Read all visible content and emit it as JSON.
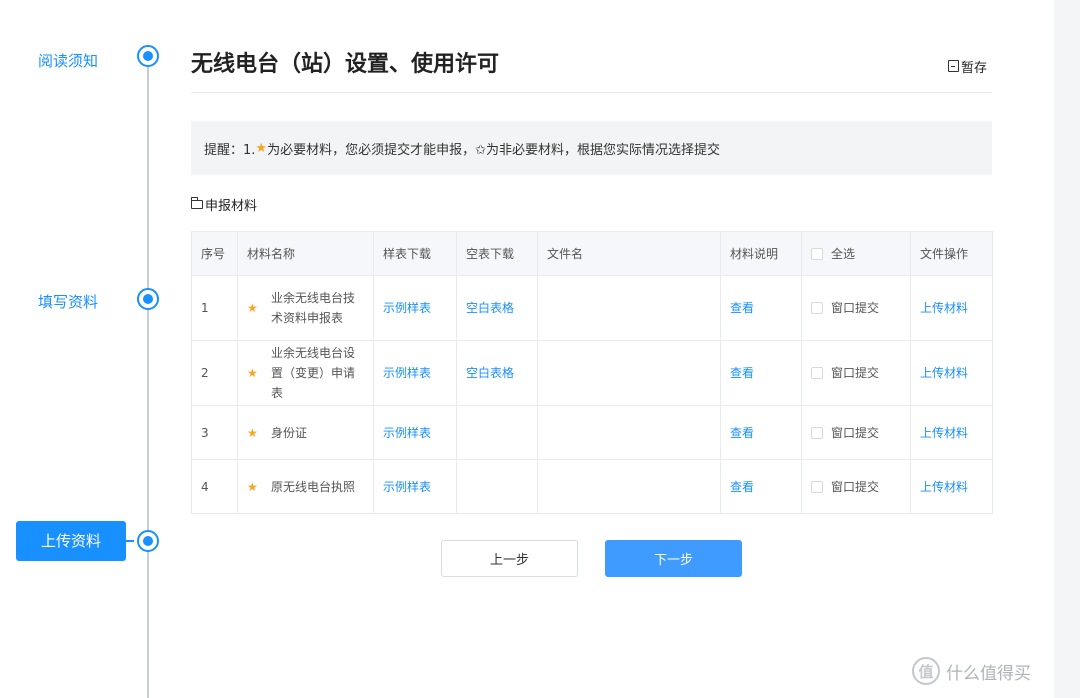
{
  "stepper": {
    "steps": [
      {
        "label": "阅读须知",
        "state": "done"
      },
      {
        "label": "填写资料",
        "state": "done"
      },
      {
        "label": "上传资料",
        "state": "active"
      }
    ]
  },
  "header": {
    "title": "无线电台（站）设置、使用许可",
    "save_label": "暂存",
    "save_icon": "save-icon"
  },
  "reminder": {
    "prefix": "提醒：1. ",
    "required_star": "★",
    "text": " 为必要材料，您必须提交才能申报，✩为非必要材料，根据您实际情况选择提交"
  },
  "section": {
    "title": "申报材料",
    "icon": "folder-icon"
  },
  "table": {
    "headers": {
      "index": "序号",
      "name": "材料名称",
      "sample": "样表下载",
      "blank": "空表下载",
      "filename": "文件名",
      "desc": "材料说明",
      "select_all": "全选",
      "ops": "文件操作"
    },
    "rows": [
      {
        "index": "1",
        "star": "★",
        "name": "业余无线电台技术资料申报表",
        "sample": "示例样表",
        "blank": "空白表格",
        "filename": "",
        "desc": "查看",
        "check": "窗口提交",
        "op": "上传材料"
      },
      {
        "index": "2",
        "star": "★",
        "name": "业余无线电台设置（变更）申请表",
        "sample": "示例样表",
        "blank": "空白表格",
        "filename": "",
        "desc": "查看",
        "check": "窗口提交",
        "op": "上传材料"
      },
      {
        "index": "3",
        "star": "★",
        "name": "身份证",
        "sample": "示例样表",
        "blank": "",
        "filename": "",
        "desc": "查看",
        "check": "窗口提交",
        "op": "上传材料"
      },
      {
        "index": "4",
        "star": "★",
        "name": "原无线电台执照",
        "sample": "示例样表",
        "blank": "",
        "filename": "",
        "desc": "查看",
        "check": "窗口提交",
        "op": "上传材料"
      }
    ]
  },
  "buttons": {
    "prev": "上一步",
    "next": "下一步"
  },
  "watermark": {
    "logo_char": "值",
    "text": "什么值得买"
  },
  "colors": {
    "accent": "#1890ff",
    "next_button": "#3f9bff",
    "star": "#f5a623"
  }
}
